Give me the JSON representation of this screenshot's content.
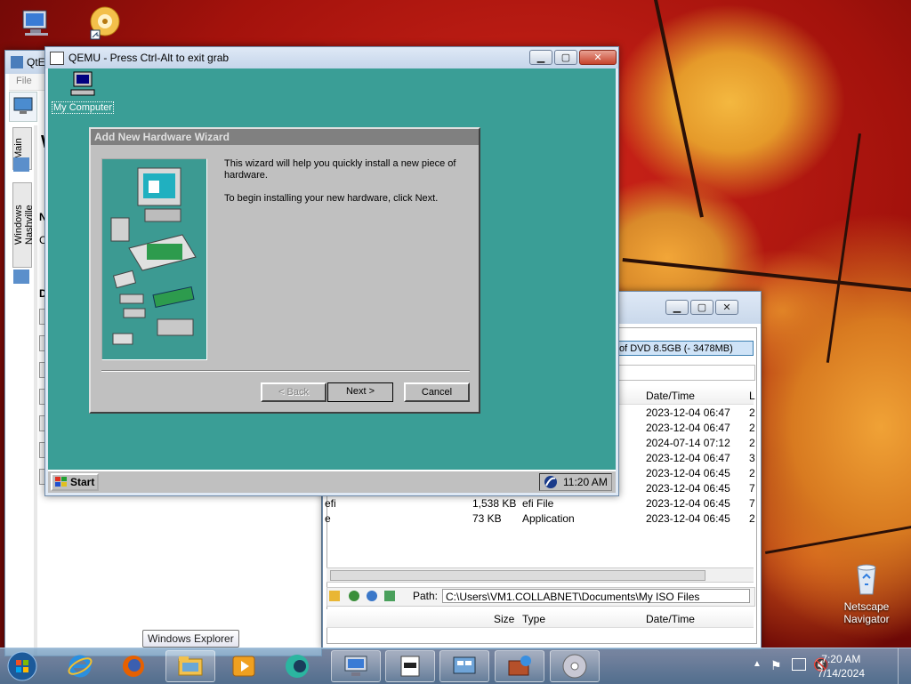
{
  "desktop": {
    "icons": [
      {
        "name": "computer"
      },
      {
        "name": "cd-shortcut"
      },
      {
        "name": "recycle-bin",
        "label": "Netscape Navigator"
      }
    ]
  },
  "qtemu": {
    "title": "QtE",
    "menu": "File",
    "tabs": [
      "Main",
      "Windows Nashville"
    ],
    "partial_labels": [
      "W",
      "N",
      "C",
      "D"
    ]
  },
  "filemgr": {
    "selected_drive": "of DVD 8.5GB (- 3478MB)",
    "columns": {
      "datetime": "Date/Time",
      "l": "L"
    },
    "rows": [
      {
        "name": "",
        "size": "",
        "type": "",
        "date": "2023-12-04 06:47",
        "x": "2"
      },
      {
        "name": "",
        "size": "",
        "type": "",
        "date": "2023-12-04 06:47",
        "x": "2"
      },
      {
        "name": "",
        "size": "",
        "type": "",
        "date": "2024-07-14 07:12",
        "x": "2"
      },
      {
        "name": "",
        "size": "",
        "type": "",
        "date": "2023-12-04 06:47",
        "x": "3"
      },
      {
        "name": "",
        "size": "",
        "type": "",
        "date": "2023-12-04 06:45",
        "x": "2"
      },
      {
        "name": "",
        "size": "",
        "type": "",
        "date": "2023-12-04 06:45",
        "x": "7"
      },
      {
        "name": "efi",
        "size": "1,538 KB",
        "type": "efi File",
        "date": "2023-12-04 06:45",
        "x": "7"
      },
      {
        "name": "e",
        "size": "73 KB",
        "type": "Application",
        "date": "2023-12-04 06:45",
        "x": "2"
      }
    ],
    "path_label": "Path:",
    "path_value": "C:\\Users\\VM1.COLLABNET\\Documents\\My ISO Files",
    "bottom_columns": {
      "size": "Size",
      "type": "Type",
      "datetime": "Date/Time"
    }
  },
  "qemu": {
    "title": "QEMU - Press Ctrl-Alt to exit grab",
    "desktop_icon_label": "My Computer",
    "wizard": {
      "title": "Add New Hardware Wizard",
      "text1": "This wizard will help you quickly install a new piece of hardware.",
      "text2": "To begin installing your new hardware, click Next.",
      "back": "< Back",
      "next": "Next >",
      "cancel": "Cancel"
    },
    "taskbar": {
      "start": "Start",
      "time": "11:20 AM"
    }
  },
  "taskbar": {
    "tooltip": "Windows Explorer",
    "time": "7:20 AM",
    "date": "7/14/2024",
    "pinned": [
      "ie",
      "firefox",
      "explorer",
      "media",
      "app",
      "computer",
      "text",
      "network",
      "firewall",
      "disc"
    ]
  },
  "colors": {
    "qemu_bg": "#3a9e96",
    "win95_gray": "#c0c0c0"
  }
}
